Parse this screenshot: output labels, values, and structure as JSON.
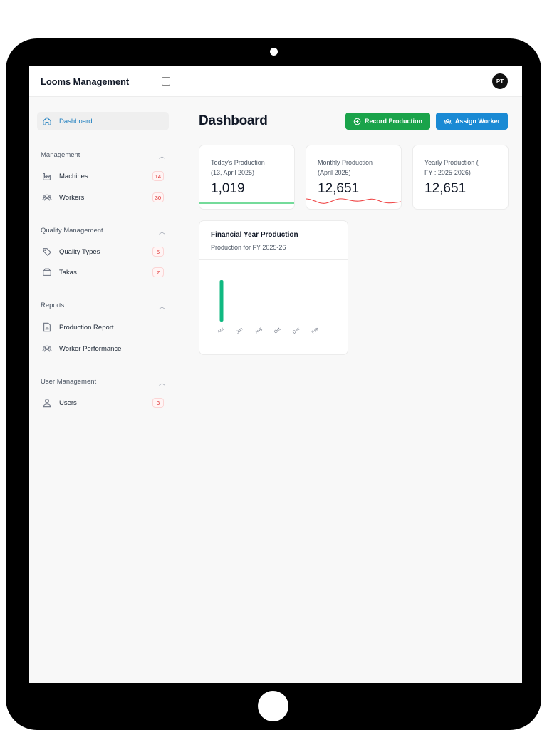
{
  "app": {
    "title": "Looms Management",
    "avatar_initials": "PT"
  },
  "sidebar": {
    "dashboard": {
      "label": "Dashboard"
    },
    "sections": [
      {
        "title": "Management",
        "items": [
          {
            "label": "Machines",
            "badge": "14"
          },
          {
            "label": "Workers",
            "badge": "30"
          }
        ]
      },
      {
        "title": "Quality Management",
        "items": [
          {
            "label": "Quality Types",
            "badge": "5"
          },
          {
            "label": "Takas",
            "badge": "7"
          }
        ]
      },
      {
        "title": "Reports",
        "items": [
          {
            "label": "Production Report"
          },
          {
            "label": "Worker Performance"
          }
        ]
      },
      {
        "title": "User Management",
        "items": [
          {
            "label": "Users",
            "badge": "3"
          }
        ]
      }
    ]
  },
  "main": {
    "title": "Dashboard",
    "record_button": "Record Production",
    "assign_button": "Assign Worker",
    "cards": [
      {
        "label": "Today's Production\n(13, April 2025)",
        "value": "1,019"
      },
      {
        "label": "Monthly Production\n(April 2025)",
        "value": "12,651"
      },
      {
        "label": "Yearly Production (\nFY : 2025-2026)",
        "value": "12,651"
      }
    ],
    "chart": {
      "title": "Financial Year Production",
      "subtitle": "Production for FY 2025-26"
    }
  },
  "colors": {
    "accent": "#1a8ad4",
    "success": "#1aa34a",
    "bar": "#10b981",
    "danger": "#dc2626"
  },
  "chart_data": {
    "type": "bar",
    "categories": [
      "Apr",
      "Jun",
      "Aug",
      "Oct",
      "Dec",
      "Feb"
    ],
    "values": [
      12651,
      0,
      0,
      0,
      0,
      0
    ],
    "title": "Financial Year Production",
    "xlabel": "",
    "ylabel": "",
    "grid": false
  }
}
